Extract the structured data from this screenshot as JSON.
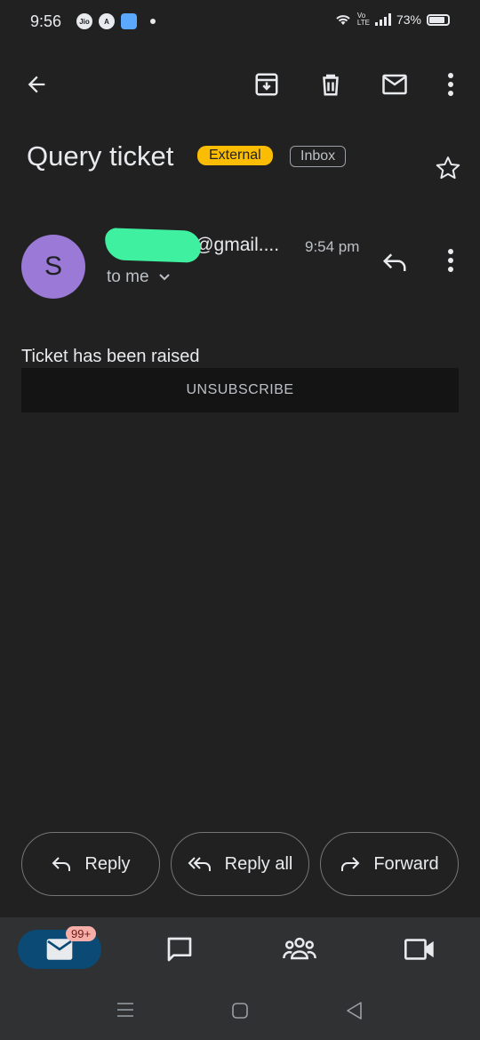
{
  "status_bar": {
    "time": "9:56",
    "battery": "73%",
    "left_icons": [
      "jio-icon",
      "app-a-icon",
      "app-square-icon"
    ],
    "right_icons": [
      "wifi-icon",
      "volte-icon",
      "signal-icon",
      "battery-icon"
    ]
  },
  "toolbar": {
    "icons": [
      "back-arrow-icon",
      "archive-icon",
      "delete-icon",
      "mark-unread-icon",
      "more-vert-icon"
    ]
  },
  "email": {
    "subject": "Query ticket",
    "label_external": "External",
    "label_inbox": "Inbox",
    "avatar_letter": "S",
    "sender": "s********18@gmail....",
    "time": "9:54 pm",
    "recipient_text": "to me",
    "body": "Ticket has been raised",
    "unsubscribe_label": "UNSUBSCRIBE"
  },
  "actions": {
    "reply": "Reply",
    "reply_all": "Reply all",
    "forward": "Forward"
  },
  "bottom_nav": {
    "mail_badge": "99+",
    "items": [
      "mail-icon",
      "chat-icon",
      "spaces-icon",
      "meet-icon"
    ]
  },
  "colors": {
    "background": "#212121",
    "external_chip": "#fbbc04",
    "avatar": "#9b79d6",
    "mail_pill": "#0b4a75",
    "badge": "#f6aea9"
  }
}
